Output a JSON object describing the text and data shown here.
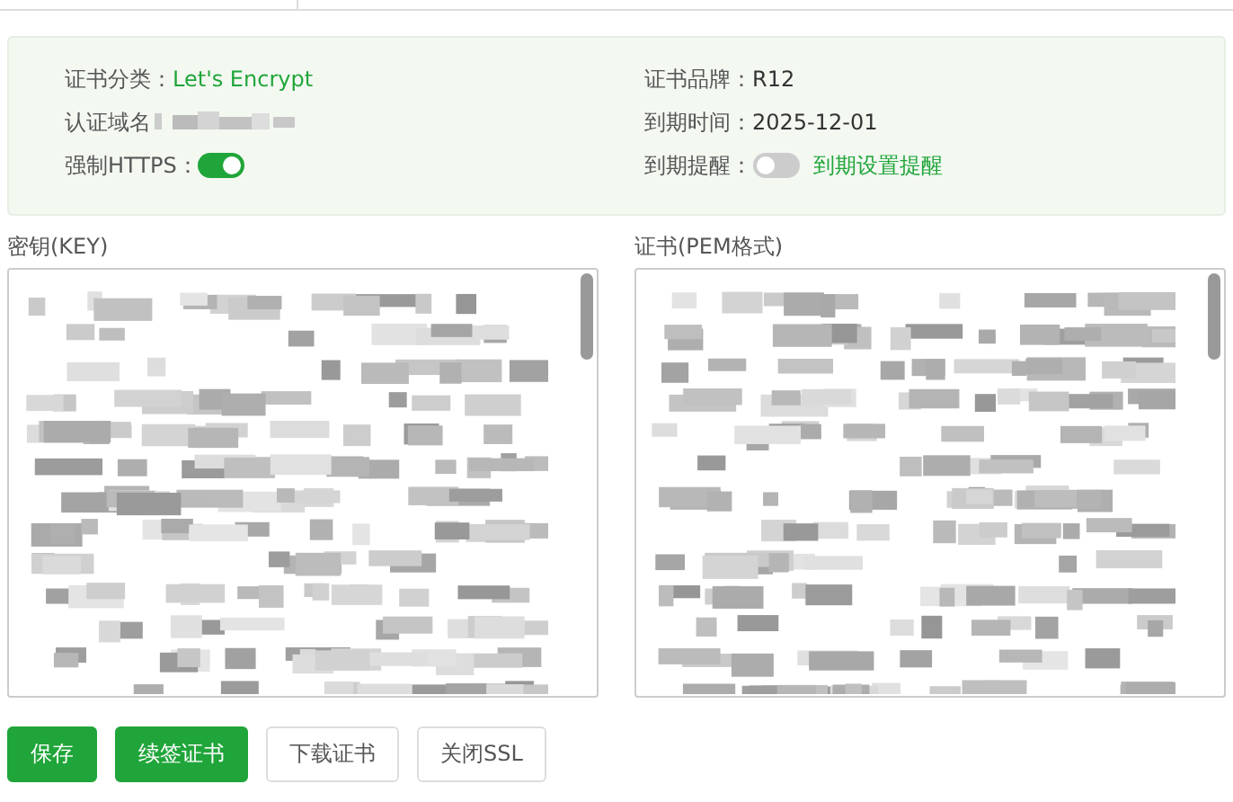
{
  "info": {
    "left": [
      {
        "kind": "link",
        "label": "证书分类：",
        "value": "Let's Encrypt"
      },
      {
        "kind": "redacted",
        "label": "认证域名"
      },
      {
        "kind": "switch",
        "label": "强制HTTPS：",
        "on": true
      }
    ],
    "right": [
      {
        "kind": "text",
        "label": "证书品牌：",
        "value": "R12"
      },
      {
        "kind": "text",
        "label": "到期时间：",
        "value": "2025-12-01"
      },
      {
        "kind": "switch",
        "label": "到期提醒：",
        "on": false,
        "link": "到期设置提醒"
      }
    ]
  },
  "editors": [
    {
      "label": "密钥(KEY)"
    },
    {
      "label": "证书(PEM格式)"
    }
  ],
  "buttons": [
    {
      "label": "保存",
      "primary": true
    },
    {
      "label": "续签证书",
      "primary": true
    },
    {
      "label": "下载证书",
      "primary": false
    },
    {
      "label": "关闭SSL",
      "primary": false
    }
  ]
}
